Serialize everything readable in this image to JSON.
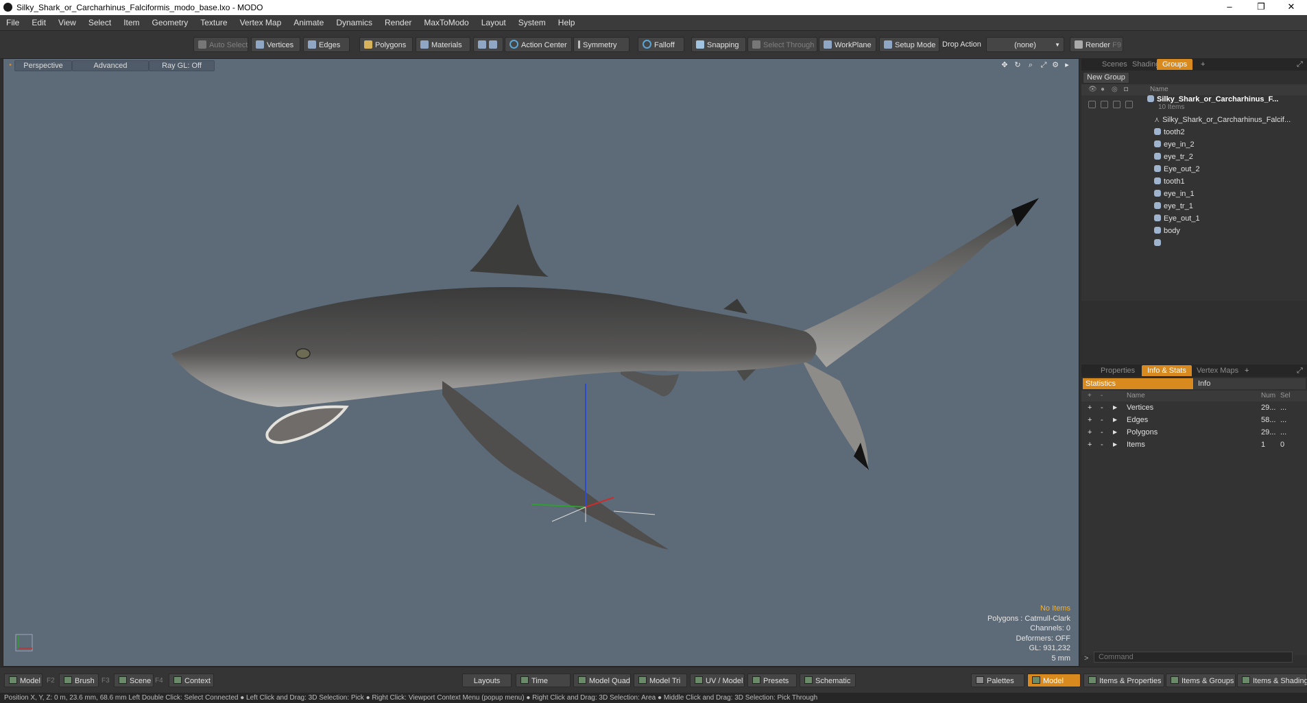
{
  "window": {
    "title": "Silky_Shark_or_Carcharhinus_Falciformis_modo_base.lxo - MODO",
    "minimize": "–",
    "restore": "❐",
    "close": "✕"
  },
  "menu": [
    "File",
    "Edit",
    "View",
    "Select",
    "Item",
    "Geometry",
    "Texture",
    "Vertex Map",
    "Animate",
    "Dynamics",
    "Render",
    "MaxToModo",
    "Layout",
    "System",
    "Help"
  ],
  "toolbar": {
    "auto_select": "Auto Select",
    "vertices": "Vertices",
    "edges": "Edges",
    "polygons": "Polygons",
    "materials": "Materials",
    "action_center": "Action Center",
    "symmetry": "Symmetry",
    "falloff": "Falloff",
    "snapping": "Snapping",
    "select_through": "Select Through",
    "workplane": "WorkPlane",
    "setup_mode": "Setup Mode",
    "drop_action_label": "Drop Action",
    "drop_action_value": "(none)",
    "render": "Render",
    "render_key": "F9"
  },
  "viewport": {
    "view": "Perspective",
    "shading": "Advanced",
    "raygl": "Ray GL: Off",
    "info": {
      "items": "No Items",
      "polygons": "Polygons : Catmull-Clark",
      "channels": "Channels: 0",
      "deformers": "Deformers: OFF",
      "gl": "GL: 931,232",
      "scale": "5 mm"
    }
  },
  "scene_panel": {
    "tabs": [
      "Scenes",
      "Shading",
      "Groups"
    ],
    "active_tab": "Groups",
    "new_group": "New Group",
    "name_header": "Name",
    "group_name": "Silky_Shark_or_Carcharhinus_F...",
    "group_count": "10 Items",
    "items": [
      "Silky_Shark_or_Carcharhinus_Falcif...",
      "tooth2",
      "eye_in_2",
      "eye_tr_2",
      "Eye_out_2",
      "tooth1",
      "eye_in_1",
      "eye_tr_1",
      "Eye_out_1",
      "body"
    ]
  },
  "stats_panel": {
    "tabs": [
      "Properties",
      "Info & Stats",
      "Vertex Maps"
    ],
    "active_tab": "Info & Stats",
    "sub_tabs": [
      "Statistics",
      "Info"
    ],
    "headers": {
      "name": "Name",
      "num": "Num",
      "sel": "Sel"
    },
    "rows": [
      {
        "name": "Vertices",
        "num": "29...",
        "sel": "..."
      },
      {
        "name": "Edges",
        "num": "58...",
        "sel": "..."
      },
      {
        "name": "Polygons",
        "num": "29...",
        "sel": "..."
      },
      {
        "name": "Items",
        "num": "1",
        "sel": "0"
      }
    ],
    "command_placeholder": "Command"
  },
  "bottom": {
    "model": "Model",
    "model_key": "F2",
    "brush": "Brush",
    "brush_key": "F3",
    "scene": "Scene",
    "scene_key": "F4",
    "context": "Context",
    "layouts": "Layouts",
    "time": "Time",
    "model_quad": "Model Quad",
    "model_tri": "Model Tri",
    "uv_model": "UV / Model",
    "presets": "Presets",
    "schematic": "Schematic",
    "palettes": "Palettes",
    "model_active": "Model",
    "items_properties": "Items & Properties",
    "items_groups": "Items & Groups",
    "items_shading": "Items & Shading"
  },
  "status": "Position X, Y, Z:   0 m, 23.6 mm, 68.6 mm        Left Double Click: Select Connected ● Left Click and Drag: 3D Selection: Pick ● Right Click: Viewport Context Menu (popup menu) ● Right Click and Drag: 3D Selection: Area ● Middle Click and Drag: 3D Selection: Pick Through",
  "colors": {
    "accent": "#d98a1f",
    "viewport_bg": "#5d6a78",
    "info_highlight": "#f5b22e"
  }
}
